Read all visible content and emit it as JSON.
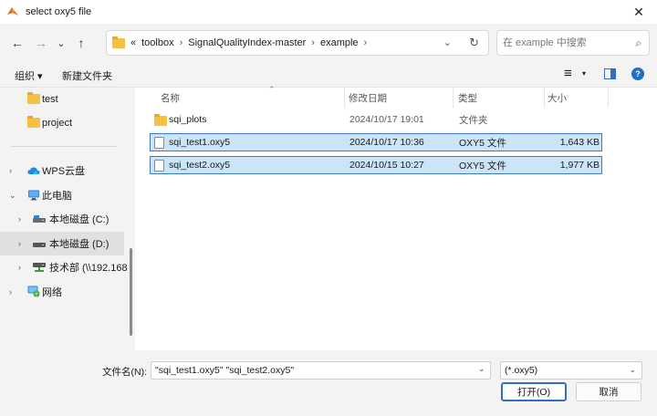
{
  "window": {
    "title": "select oxy5 file",
    "close_glyph": "✕"
  },
  "nav": {
    "back_glyph": "←",
    "forward_glyph": "→",
    "recent_glyph": "⌄",
    "up_glyph": "↑",
    "breadcrumb": {
      "overflow": "«",
      "items": [
        "toolbox",
        "SignalQualityIndex-master",
        "example"
      ],
      "sep": "›"
    },
    "address_dropdown_glyph": "⌄",
    "refresh_glyph": "↻"
  },
  "search": {
    "placeholder": "在 example 中搜索",
    "icon_glyph": "⌕"
  },
  "toolbar": {
    "organize": "组织 ▾",
    "new_folder": "新建文件夹",
    "view_glyph": "≡",
    "view_caret": "▾",
    "help_glyph": "?"
  },
  "sidebar": {
    "items": [
      {
        "label": "test",
        "icon": "folder-icon"
      },
      {
        "label": "project",
        "icon": "folder-icon"
      },
      {
        "label": "WPS云盘",
        "icon": "cloud-icon",
        "chevron": "›"
      },
      {
        "label": "此电脑",
        "icon": "computer-icon",
        "chevron": "⌄"
      },
      {
        "label": "本地磁盘 (C:)",
        "icon": "drive-icon",
        "chevron": "›"
      },
      {
        "label": "本地磁盘 (D:)",
        "icon": "drive-icon",
        "chevron": "›"
      },
      {
        "label": "技术部 (\\\\192.168",
        "icon": "network-drive-icon",
        "chevron": "›"
      },
      {
        "label": "网络",
        "icon": "network-icon",
        "chevron": "›"
      }
    ]
  },
  "columns": {
    "name": "名称",
    "date": "修改日期",
    "type": "类型",
    "size": "大小",
    "sort_caret": "⌃"
  },
  "files": [
    {
      "name": "sqi_plots",
      "date": "2024/10/17 19:01",
      "type": "文件夹",
      "size": "",
      "kind": "folder"
    },
    {
      "name": "sqi_test1.oxy5",
      "date": "2024/10/17 10:36",
      "type": "OXY5 文件",
      "size": "1,643 KB",
      "kind": "file"
    },
    {
      "name": "sqi_test2.oxy5",
      "date": "2024/10/15 10:27",
      "type": "OXY5 文件",
      "size": "1,977 KB",
      "kind": "file"
    }
  ],
  "footer": {
    "filename_label": "文件名(N):",
    "filename_value": "\"sqi_test1.oxy5\" \"sqi_test2.oxy5\"",
    "filename_drop": "⌄",
    "filetype": "(*.oxy5)",
    "filetype_drop": "⌄",
    "open_label": "打开(O)",
    "cancel_label": "取消"
  },
  "colors": {
    "accent": "#2f6fbd",
    "selection": "#cce4f7",
    "folder": "#f5c143"
  }
}
